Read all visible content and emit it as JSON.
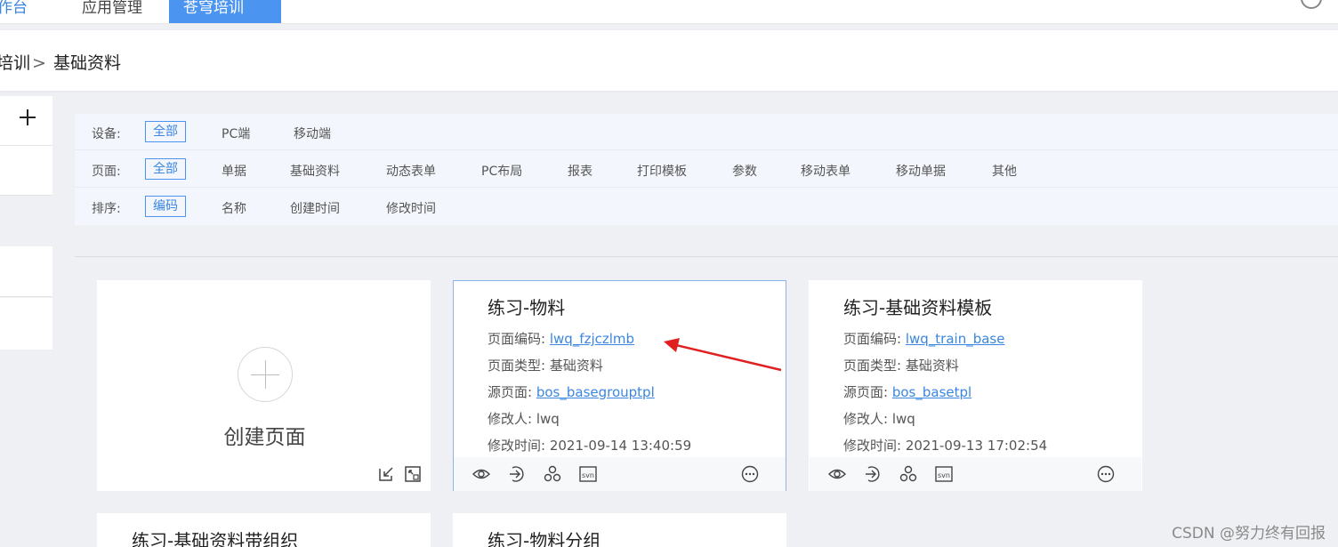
{
  "topnav": {
    "tabs": [
      {
        "label": "工作台"
      },
      {
        "label": "应用管理"
      },
      {
        "label": "苍穹培训"
      }
    ]
  },
  "breadcrumb": {
    "parent": "培训",
    "separator": ">",
    "current": "基础资料"
  },
  "filters": {
    "device": {
      "label": "设备:",
      "options": [
        "全部",
        "PC端",
        "移动端"
      ],
      "selected": "全部"
    },
    "page": {
      "label": "页面:",
      "options": [
        "全部",
        "单据",
        "基础资料",
        "动态表单",
        "PC布局",
        "报表",
        "打印模板",
        "参数",
        "移动表单",
        "移动单据",
        "其他"
      ],
      "selected": "全部"
    },
    "sort": {
      "label": "排序:",
      "options": [
        "编码",
        "名称",
        "创建时间",
        "修改时间"
      ],
      "selected": "编码"
    }
  },
  "create_card": {
    "label": "创建页面"
  },
  "field_labels": {
    "code": "页面编码:",
    "type": "页面类型:",
    "source": "源页面:",
    "modifier": "修改人:",
    "modified_time": "修改时间:"
  },
  "cards": [
    {
      "title": "练习-物料",
      "code": "lwq_fzjczlmb",
      "type": "基础资料",
      "source": "bos_basegrouptpl",
      "modifier": "lwq",
      "modified_time": "2021-09-14 13:40:59"
    },
    {
      "title": "练习-基础资料模板",
      "code": "lwq_train_base",
      "type": "基础资料",
      "source": "bos_basetpl",
      "modifier": "lwq",
      "modified_time": "2021-09-13 17:02:54"
    }
  ],
  "partial_cards": [
    {
      "title": "练习-基础资料带组织"
    },
    {
      "title": "练习-物料分组"
    }
  ],
  "icons": {
    "svn_text": "svn",
    "arrow_color": "#e02020",
    "accent": "#4b94f0",
    "link_color": "#3a86e0"
  },
  "watermark": "CSDN @努力终有回报"
}
